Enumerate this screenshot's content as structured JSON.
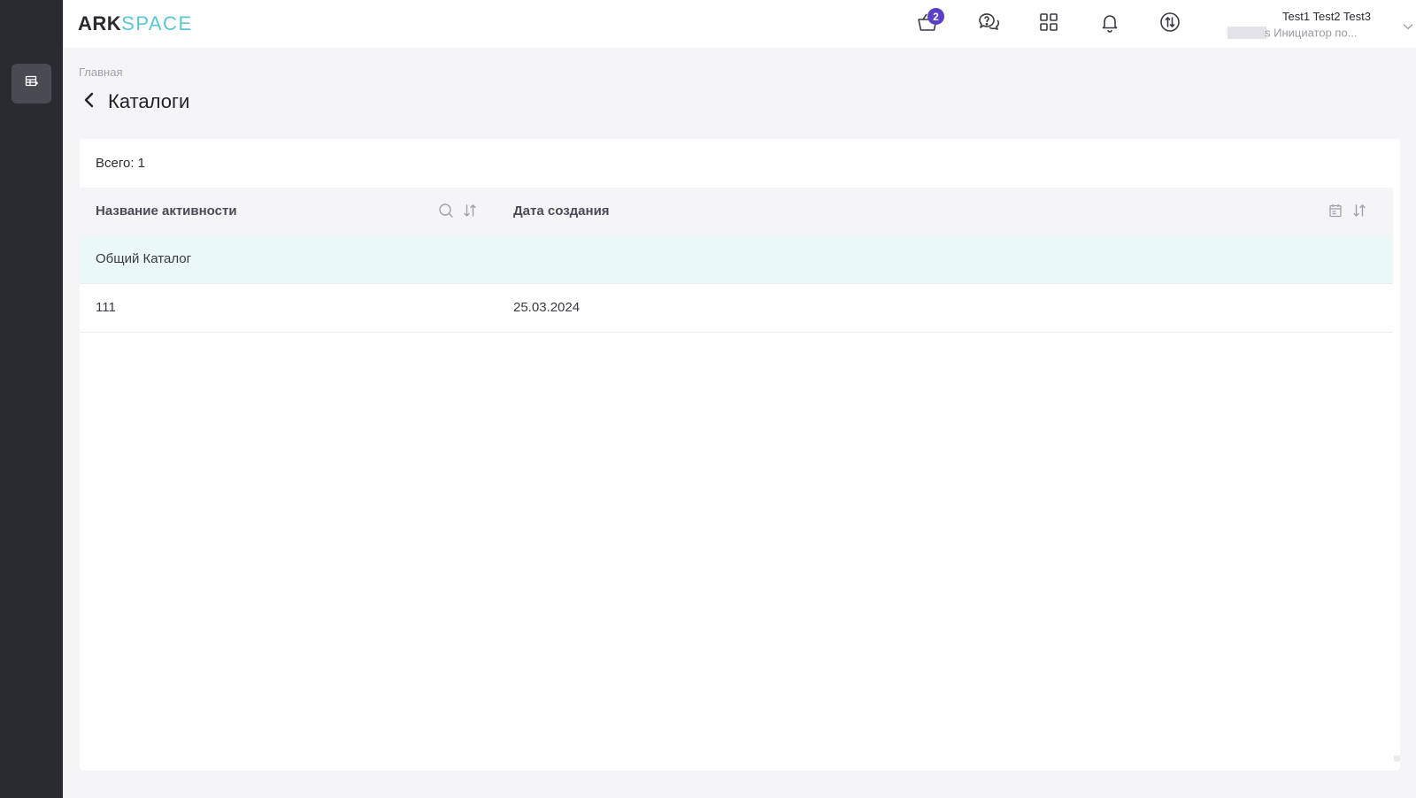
{
  "app": {
    "logo_part1": "ARK",
    "logo_part2": "SPACE",
    "accent": "#58c7d2",
    "sidebar_bg": "#2a2a31"
  },
  "header": {
    "cart_badge": "2",
    "badge_color": "#5b3fc6",
    "user_name": "Test1 Test2 Test3",
    "user_role": "s Инициатор по..."
  },
  "breadcrumb": "Главная",
  "page": {
    "title": "Каталоги",
    "total": "Всего: 1"
  },
  "table": {
    "columns": [
      "Название активности",
      "Дата создания"
    ],
    "rows": [
      {
        "name": "Общий Каталог",
        "date": ""
      },
      {
        "name": "111",
        "date": "25.03.2024"
      }
    ],
    "selected_row_color": "#eaf8f8"
  },
  "icons": {
    "sidebar": "catalog-icon",
    "cart": "basket-icon",
    "support": "help-chat-icon",
    "apps": "grid-icon",
    "notifications": "bell-icon",
    "switch": "swap-icon",
    "user_menu": "chevron-down-icon",
    "back": "chevron-left-icon",
    "search": "search-icon",
    "sort": "sort-icon",
    "calendar": "calendar-icon"
  }
}
